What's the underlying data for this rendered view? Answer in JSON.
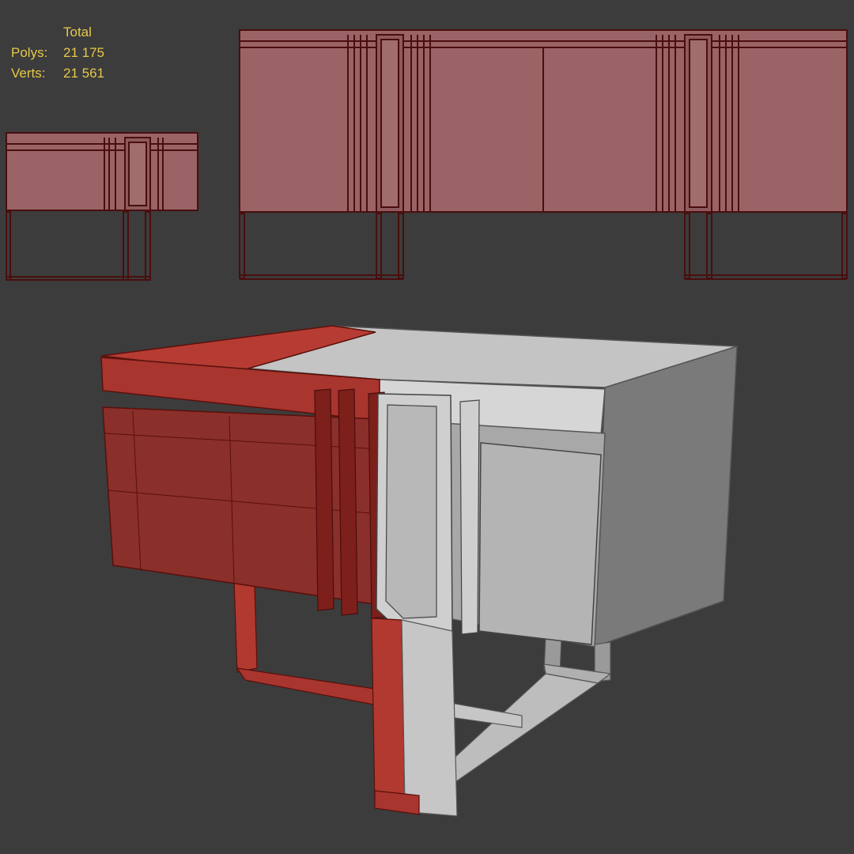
{
  "viewport": {
    "background": "#3c3c3c"
  },
  "stats": {
    "header": "Total",
    "polys_label": "Polys:",
    "polys_value": "21 175",
    "verts_label": "Verts:",
    "verts_value": "21 561",
    "color": "#e6c84a"
  },
  "colors": {
    "wire_face": "#9a6466",
    "wire_edge": "#4a0e0e",
    "wire_red": "#8b2f2a",
    "shaded_light": "#cfcfcf",
    "shaded_mid": "#a8a8a8",
    "shaded_dark": "#7a7a7a"
  },
  "views": {
    "side": "side-view-sideboard",
    "front": "front-view-sideboard",
    "perspective": "perspective-view-sideboard"
  }
}
